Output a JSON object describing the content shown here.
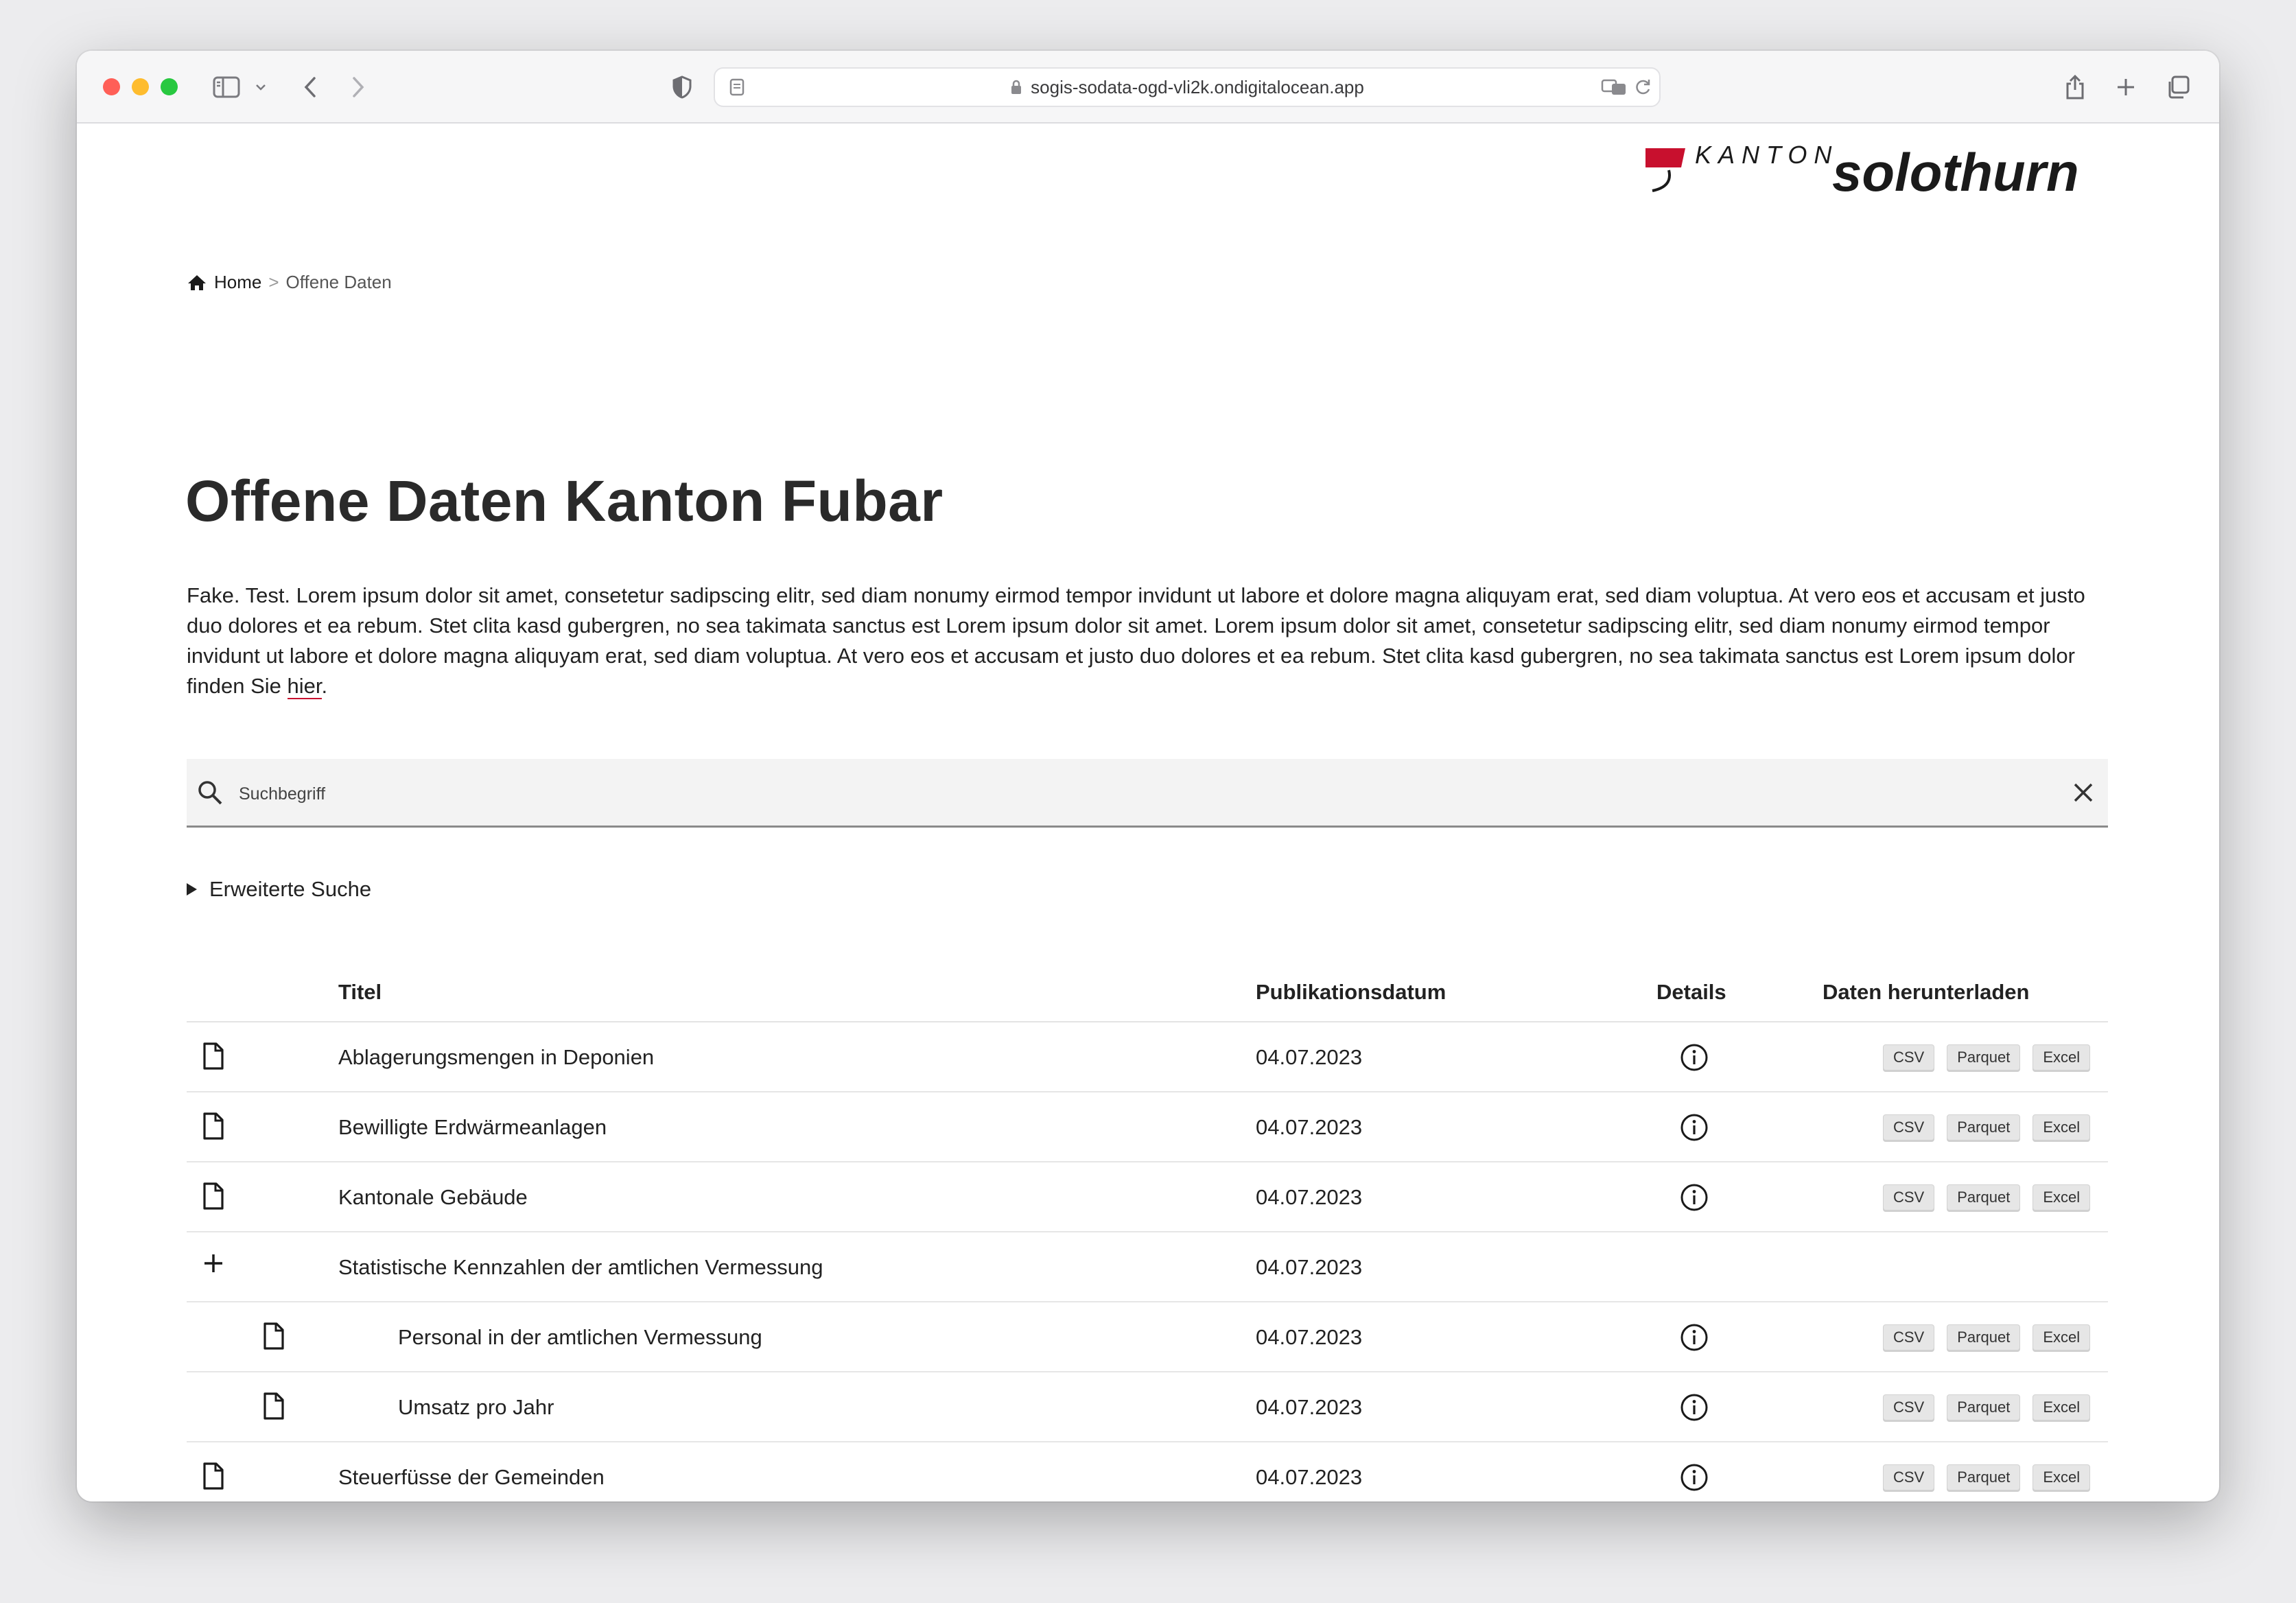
{
  "browser": {
    "url": "sogis-sodata-ogd-vli2k.ondigitalocean.app"
  },
  "logo": {
    "top_word": "KANTON",
    "main_word": "solothurn",
    "brand_color": "#c8102e"
  },
  "breadcrumb": {
    "home": "Home",
    "separator": ">",
    "current": "Offene Daten"
  },
  "page": {
    "title": "Offene Daten Kanton Fubar",
    "intro": "Fake. Test. Lorem ipsum dolor sit amet, consetetur sadipscing elitr, sed diam nonumy eirmod tempor invidunt ut labore et dolore magna aliquyam erat, sed diam voluptua. At vero eos et accusam et justo duo dolores et ea rebum. Stet clita kasd gubergren, no sea takimata sanctus est Lorem ipsum dolor sit amet. Lorem ipsum dolor sit amet, consetetur sadipscing elitr, sed diam nonumy eirmod tempor invidunt ut labore et dolore magna aliquyam erat, sed diam voluptua. At vero eos et accusam et justo duo dolores et ea rebum. Stet clita kasd gubergren, no sea takimata sanctus est Lorem ipsum dolor finden Sie",
    "intro_link": "hier",
    "intro_end": "."
  },
  "search": {
    "placeholder": "Suchbegriff"
  },
  "advanced_search": {
    "label": "Erweiterte Suche"
  },
  "table": {
    "headers": {
      "title": "Titel",
      "date": "Publikationsdatum",
      "details": "Details",
      "download": "Daten herunterladen"
    },
    "download_formats": [
      "CSV",
      "Parquet",
      "Excel"
    ],
    "rows": [
      {
        "title": "Ablagerungsmengen in Deponien",
        "date": "04.07.2023",
        "type": "file",
        "indent": false
      },
      {
        "title": "Bewilligte Erdwärmeanlagen",
        "date": "04.07.2023",
        "type": "file",
        "indent": false
      },
      {
        "title": "Kantonale Gebäude",
        "date": "04.07.2023",
        "type": "file",
        "indent": false
      },
      {
        "title": "Statistische Kennzahlen der amtlichen Vermessung",
        "date": "04.07.2023",
        "type": "group",
        "indent": false
      },
      {
        "title": "Personal in der amtlichen Vermessung",
        "date": "04.07.2023",
        "type": "file",
        "indent": true
      },
      {
        "title": "Umsatz pro Jahr",
        "date": "04.07.2023",
        "type": "file",
        "indent": true
      },
      {
        "title": "Steuerfüsse der Gemeinden",
        "date": "04.07.2023",
        "type": "file",
        "indent": false
      }
    ]
  }
}
